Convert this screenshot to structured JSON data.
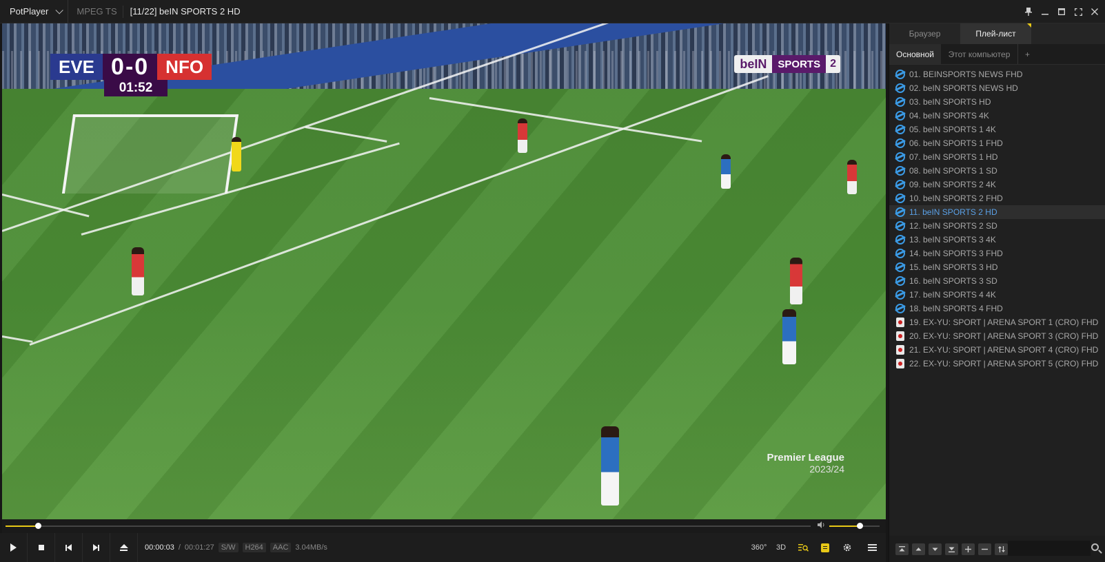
{
  "titlebar": {
    "app_name": "PotPlayer",
    "format": "MPEG TS",
    "title": "[11/22] beIN SPORTS 2 HD",
    "buttons": [
      "pin-icon",
      "minimize-icon",
      "maximize-icon",
      "fullscreen-icon",
      "close-icon"
    ]
  },
  "video": {
    "scorebug": {
      "home": "EVE",
      "score": "0-0",
      "away": "NFO",
      "clock": "01:52"
    },
    "channel_logo": {
      "part1": "beIN",
      "part2": "SPORTS",
      "part3": "2"
    },
    "watermark": {
      "line1": "Premier League",
      "line2": "2023/24"
    }
  },
  "playback": {
    "current_time": "00:00:03",
    "separator": "/",
    "total_time": "00:01:27",
    "tags": [
      "S/W",
      "H264",
      "AAC"
    ],
    "rate": "3.04MB/s",
    "progress": 0.04,
    "volume": 0.6,
    "right_controls": [
      "360°",
      "3D"
    ]
  },
  "panel": {
    "tabs": [
      "Браузер",
      "Плей-лист"
    ],
    "active_tab": 1,
    "subtabs": [
      "Основной",
      "Этот компьютер",
      "+"
    ],
    "search": {
      "placeholder": ""
    },
    "items": [
      {
        "label": "01. BEINSPORTS NEWS FHD",
        "icon": "ie-icon"
      },
      {
        "label": "02. beIN SPORTS NEWS HD",
        "icon": "ie-icon"
      },
      {
        "label": "03. beIN SPORTS HD",
        "icon": "ie-icon"
      },
      {
        "label": "04. beIN SPORTS 4K",
        "icon": "ie-icon"
      },
      {
        "label": "05. beIN SPORTS 1 4K",
        "icon": "ie-icon"
      },
      {
        "label": "06. beIN SPORTS 1 FHD",
        "icon": "ie-icon"
      },
      {
        "label": "07. beIN SPORTS 1 HD",
        "icon": "ie-icon"
      },
      {
        "label": "08. beIN SPORTS 1 SD",
        "icon": "ie-icon"
      },
      {
        "label": "09. beIN SPORTS 2 4K",
        "icon": "ie-icon"
      },
      {
        "label": "10. beIN SPORTS 2 FHD",
        "icon": "ie-icon"
      },
      {
        "label": "11. beIN SPORTS 2 HD",
        "icon": "ie-icon",
        "active": true
      },
      {
        "label": "12. beIN SPORTS 2 SD",
        "icon": "ie-icon"
      },
      {
        "label": "13. beIN SPORTS 3 4K",
        "icon": "ie-icon"
      },
      {
        "label": "14. beIN SPORTS 3 FHD",
        "icon": "ie-icon"
      },
      {
        "label": "15. beIN SPORTS 3 HD",
        "icon": "ie-icon"
      },
      {
        "label": "16. beIN SPORTS 3 SD",
        "icon": "ie-icon"
      },
      {
        "label": "17. beIN SPORTS 4 4K",
        "icon": "ie-icon"
      },
      {
        "label": "18. beIN SPORTS 4 FHD",
        "icon": "ie-icon"
      },
      {
        "label": "19. EX-YU: SPORT | ARENA SPORT 1 (CRO) FHD",
        "icon": "video-file-icon"
      },
      {
        "label": "20. EX-YU: SPORT | ARENA SPORT 3 (CRO) FHD",
        "icon": "video-file-icon"
      },
      {
        "label": "21. EX-YU: SPORT | ARENA SPORT 4 (CRO) FHD",
        "icon": "video-file-icon"
      },
      {
        "label": "22. EX-YU: SPORT | ARENA SPORT 5 (CRO) FHD",
        "icon": "video-file-icon"
      }
    ]
  },
  "colors": {
    "accent": "#e8c817",
    "active_item": "#5aa0e6",
    "ie_blue": "#3b9be6"
  }
}
